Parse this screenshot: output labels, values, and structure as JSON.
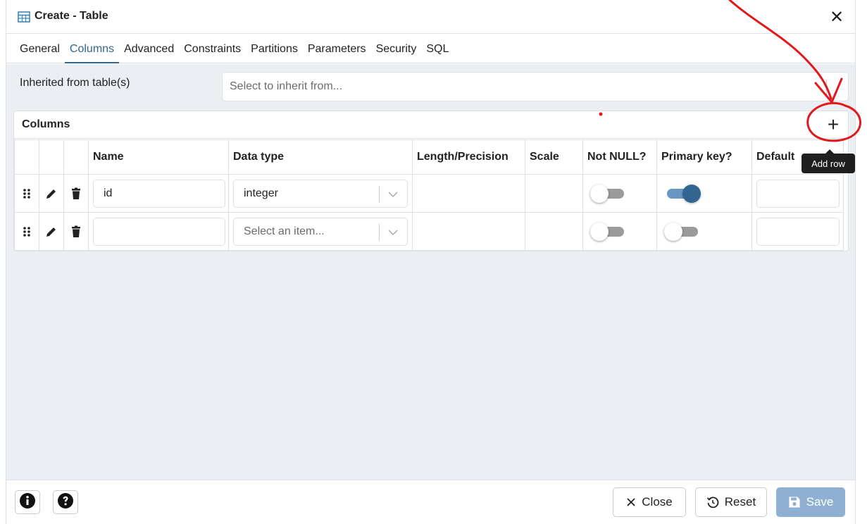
{
  "dialog": {
    "title": "Create - Table",
    "close_glyph": "✕"
  },
  "tabs": [
    {
      "label": "General",
      "active": false
    },
    {
      "label": "Columns",
      "active": true
    },
    {
      "label": "Advanced",
      "active": false
    },
    {
      "label": "Constraints",
      "active": false
    },
    {
      "label": "Partitions",
      "active": false
    },
    {
      "label": "Parameters",
      "active": false
    },
    {
      "label": "Security",
      "active": false
    },
    {
      "label": "SQL",
      "active": false
    }
  ],
  "inherit": {
    "label": "Inherited from table(s)",
    "placeholder": "Select to inherit from..."
  },
  "columns_grid": {
    "title": "Columns",
    "add_glyph": "+",
    "add_tooltip": "Add row",
    "headers": [
      "Name",
      "Data type",
      "Length/Precision",
      "Scale",
      "Not NULL?",
      "Primary key?",
      "Default"
    ],
    "rows": [
      {
        "name": "id",
        "data_type": "integer",
        "data_type_placeholder": false,
        "not_null": false,
        "primary_key": true
      },
      {
        "name": "",
        "data_type": "Select an item...",
        "data_type_placeholder": true,
        "not_null": false,
        "primary_key": false
      }
    ]
  },
  "footer": {
    "close_label": "Close",
    "reset_label": "Reset",
    "save_label": "Save"
  },
  "icons": {
    "table": "table-icon",
    "drag": "drag-handle-icon",
    "edit": "pencil-icon",
    "delete": "trash-icon",
    "info": "info-icon",
    "help": "help-icon",
    "close": "close-icon",
    "reset": "reset-icon",
    "save": "floppy-disk-icon"
  },
  "colors": {
    "accent": "#326690",
    "toggle_on_track": "#6a96c4",
    "content_bg": "#ebeef3",
    "annotation": "#e0191c"
  }
}
